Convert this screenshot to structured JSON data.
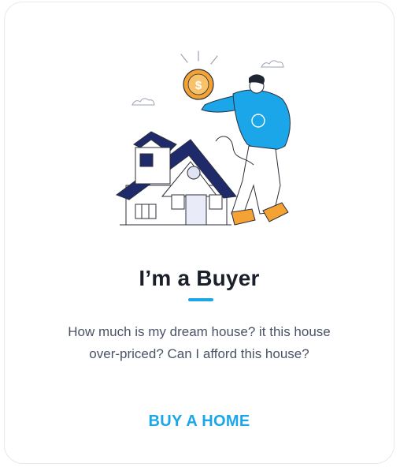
{
  "card": {
    "title": "I’m a Buyer",
    "description_line1": "How much is my dream house? it this house",
    "description_line2": "over-priced? Can I afford this house?",
    "cta_label": "BUY A HOME"
  },
  "illustration": {
    "coin_symbol": "$",
    "subject": "person-holding-coin-next-to-house-icon"
  },
  "colors": {
    "accent": "#1aa6e8",
    "navy": "#1f2a6b",
    "orange": "#f3a233",
    "shirt": "#1aa6e8",
    "title": "#1a1f29",
    "text": "#4a5366"
  }
}
